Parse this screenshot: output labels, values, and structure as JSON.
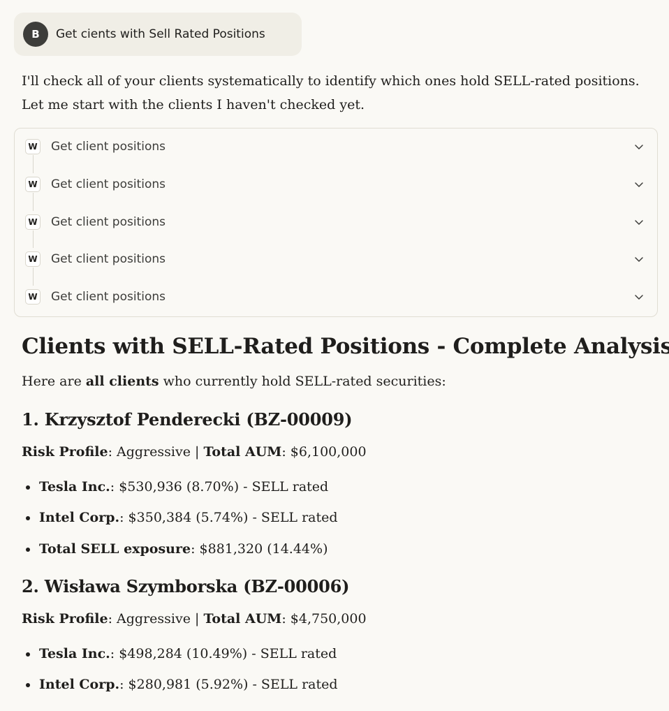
{
  "user_message": {
    "avatar_initial": "B",
    "text": "Get cients with Sell Rated Positions"
  },
  "assistant": {
    "intro_line1": "I'll check all of your clients systematically to identify which ones hold SELL-rated positions.",
    "intro_line2": "Let me start with the clients I haven't checked yet.",
    "tool_calls": [
      {
        "badge": "W",
        "label": "Get client positions"
      },
      {
        "badge": "W",
        "label": "Get client positions"
      },
      {
        "badge": "W",
        "label": "Get client positions"
      },
      {
        "badge": "W",
        "label": "Get client positions"
      },
      {
        "badge": "W",
        "label": "Get client positions"
      }
    ],
    "heading": "Clients with SELL-Rated Positions - Complete Analysis",
    "summary_prefix": "Here are ",
    "summary_bold": "all clients",
    "summary_suffix": " who currently hold SELL-rated securities:",
    "clients": [
      {
        "title": "1. Krzysztof Penderecki (BZ-00009)",
        "risk_label": "Risk Profile",
        "risk_value": ": Aggressive | ",
        "aum_label": "Total AUM",
        "aum_value": ": $6,100,000",
        "positions": [
          {
            "name": "Tesla Inc.",
            "detail": ": $530,936 (8.70%) - SELL rated"
          },
          {
            "name": "Intel Corp.",
            "detail": ": $350,384 (5.74%) - SELL rated"
          },
          {
            "name": "Total SELL exposure",
            "detail": ": $881,320 (14.44%)"
          }
        ]
      },
      {
        "title": "2. Wisława Szymborska (BZ-00006)",
        "risk_label": "Risk Profile",
        "risk_value": ": Aggressive | ",
        "aum_label": "Total AUM",
        "aum_value": ": $4,750,000",
        "positions": [
          {
            "name": "Tesla Inc.",
            "detail": ": $498,284 (10.49%) - SELL rated"
          },
          {
            "name": "Intel Corp.",
            "detail": ": $280,981 (5.92%) - SELL rated"
          }
        ]
      }
    ]
  }
}
